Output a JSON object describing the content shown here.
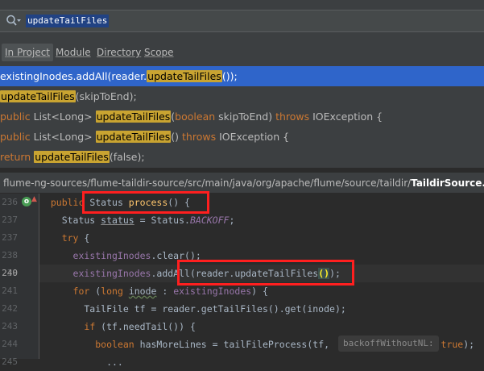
{
  "search": {
    "query": "updateTailFiles"
  },
  "tabs": [
    {
      "label": "In Project",
      "active": true
    },
    {
      "label": "Module",
      "active": false
    },
    {
      "label": "Directory",
      "active": false
    },
    {
      "label": "Scope",
      "active": false
    }
  ],
  "results": [
    {
      "pre": "existingInodes.addAll(reader.",
      "kw": "",
      "post": "(reader.",
      "match": "updateTailFiles",
      "tail": "());",
      "selected": true
    },
    {
      "match": "updateTailFiles",
      "tail": "(skipToEnd);"
    },
    {
      "pre": "public List<Long> ",
      "match": "updateTailFiles",
      "tail_a": "(",
      "kw1": "boolean",
      "tail_b": " skipToEnd) ",
      "kw2": "throws",
      "tail_c": " IOException {"
    },
    {
      "pre": "public List<Long> ",
      "match": "updateTailFiles",
      "tail_a": "() ",
      "kw2": "throws",
      "tail_c": " IOException {"
    },
    {
      "kw1": "return",
      "pre": " ",
      "match": "updateTailFiles",
      "tail": "(false);"
    }
  ],
  "file_path": {
    "dir": "flume-ng-sources/flume-taildir-source/src/main/java/org/apache/flume/source/taildir/",
    "file": "TaildirSource.java"
  },
  "editor": {
    "line_numbers": [
      "236",
      "237",
      "237",
      "238",
      "239",
      "240",
      "241",
      "242",
      "243",
      "244",
      "245"
    ],
    "hint": "backoffWithoutNL:"
  }
}
